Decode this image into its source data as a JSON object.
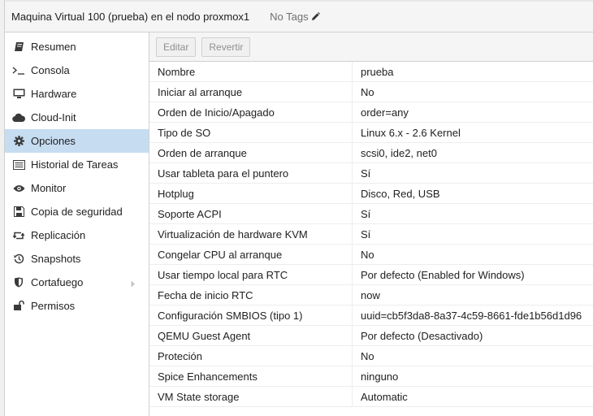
{
  "header": {
    "title": "Maquina Virtual 100 (prueba) en el nodo proxmox1",
    "tags": "No Tags"
  },
  "sidebar": {
    "items": [
      {
        "label": "Resumen",
        "icon": "book-icon",
        "active": false
      },
      {
        "label": "Consola",
        "icon": "terminal-icon",
        "active": false
      },
      {
        "label": "Hardware",
        "icon": "monitor-icon",
        "active": false
      },
      {
        "label": "Cloud-Init",
        "icon": "cloud-icon",
        "active": false
      },
      {
        "label": "Opciones",
        "icon": "gear-icon",
        "active": true
      },
      {
        "label": "Historial de Tareas",
        "icon": "list-icon",
        "active": false
      },
      {
        "label": "Monitor",
        "icon": "eye-icon",
        "active": false
      },
      {
        "label": "Copia de seguridad",
        "icon": "floppy-icon",
        "active": false
      },
      {
        "label": "Replicación",
        "icon": "retweet-icon",
        "active": false
      },
      {
        "label": "Snapshots",
        "icon": "history-icon",
        "active": false
      },
      {
        "label": "Cortafuego",
        "icon": "shield-icon",
        "active": false
      },
      {
        "label": "Permisos",
        "icon": "unlock-icon",
        "active": false
      }
    ]
  },
  "toolbar": {
    "edit_label": "Editar",
    "revert_label": "Revertir"
  },
  "options": {
    "rows": [
      {
        "key": "Nombre",
        "value": "prueba"
      },
      {
        "key": "Iniciar al arranque",
        "value": "No"
      },
      {
        "key": "Orden de Inicio/Apagado",
        "value": "order=any"
      },
      {
        "key": "Tipo de SO",
        "value": "Linux 6.x - 2.6 Kernel"
      },
      {
        "key": "Orden de arranque",
        "value": "scsi0, ide2, net0"
      },
      {
        "key": "Usar tableta para el puntero",
        "value": "Sí"
      },
      {
        "key": "Hotplug",
        "value": "Disco, Red, USB"
      },
      {
        "key": "Soporte ACPI",
        "value": "Sí"
      },
      {
        "key": "Virtualización de hardware KVM",
        "value": "Sí"
      },
      {
        "key": "Congelar CPU al arranque",
        "value": "No"
      },
      {
        "key": "Usar tiempo local para RTC",
        "value": "Por defecto (Enabled for Windows)"
      },
      {
        "key": "Fecha de inicio RTC",
        "value": "now"
      },
      {
        "key": "Configuración SMBIOS (tipo 1)",
        "value": "uuid=cb5f3da8-8a37-4c59-8661-fde1b56d1d96"
      },
      {
        "key": "QEMU Guest Agent",
        "value": "Por defecto (Desactivado)"
      },
      {
        "key": "Proteción",
        "value": "No"
      },
      {
        "key": "Spice Enhancements",
        "value": "ninguno"
      },
      {
        "key": "VM State storage",
        "value": "Automatic"
      }
    ]
  },
  "colors": {
    "active_item": "#c6dcf1",
    "header_bg": "#f5f5f5",
    "border": "#d0d0d0"
  }
}
